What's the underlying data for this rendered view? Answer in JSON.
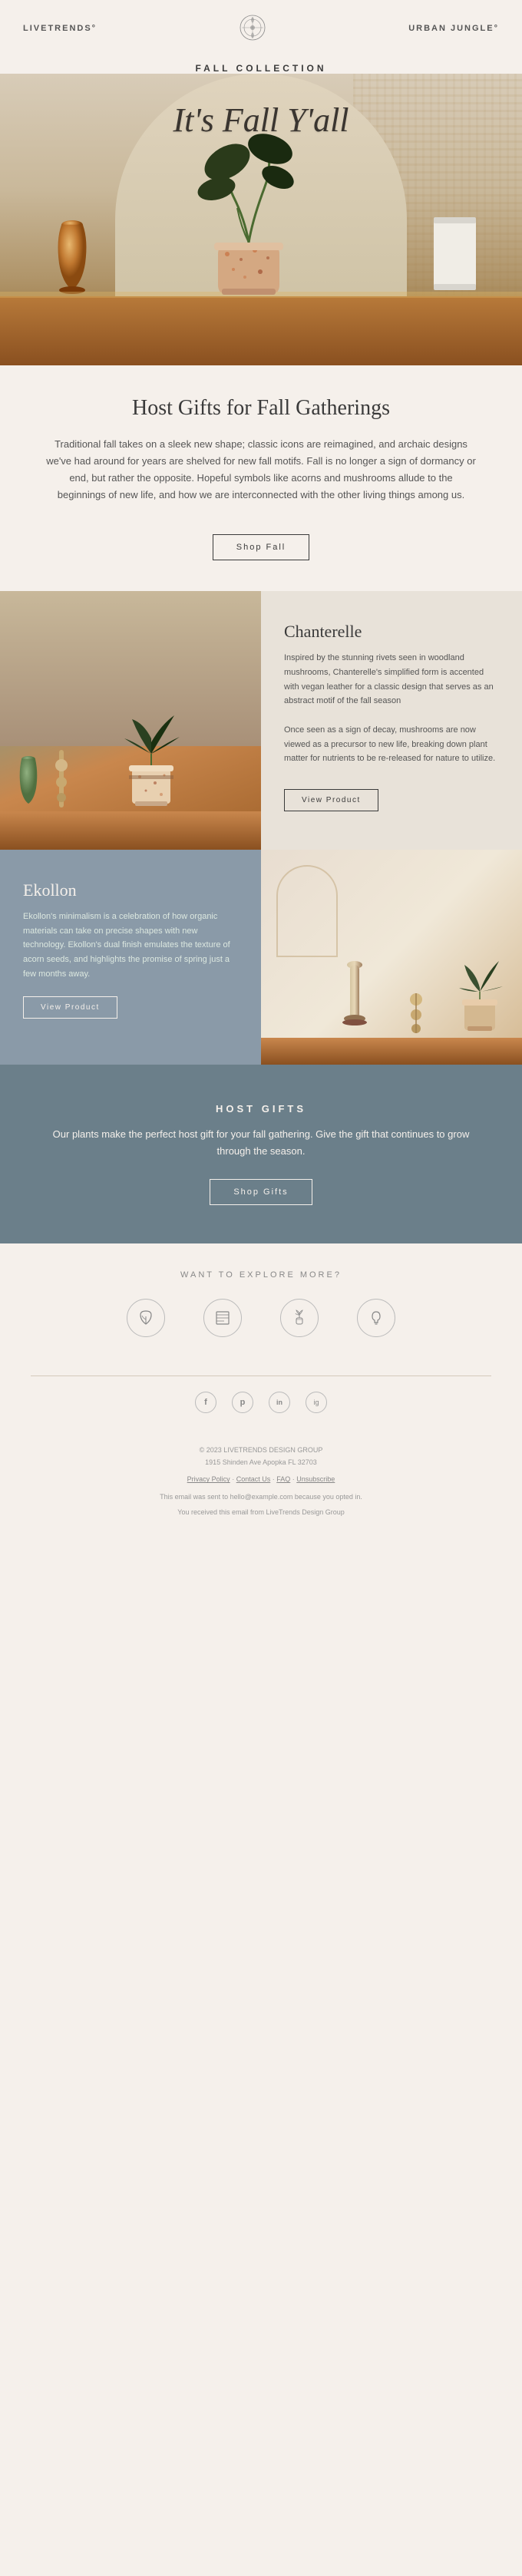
{
  "header": {
    "logo_left": "LIVETRENDS°",
    "logo_right": "URBAN JUNGLE°",
    "emblem_alt": "emblem"
  },
  "collection": {
    "label": "FALL COLLECTION",
    "hero_title": "It's Fall Y'all"
  },
  "hosting_section": {
    "heading": "Host Gifts for Fall Gatherings",
    "body": "Traditional fall takes on a sleek new shape; classic icons are reimagined, and archaic designs we've had around for years are shelved for new fall motifs. Fall is no longer a sign of dormancy or end, but rather the opposite. Hopeful symbols like acorns and mushrooms allude to the beginnings of new life, and how we are interconnected with the other living things among us.",
    "cta_label": "Shop Fall"
  },
  "products": {
    "chanterelle": {
      "name": "Chanterelle",
      "description": "Inspired by the stunning rivets seen in woodland mushrooms, Chanterelle's simplified form is accented with vegan leather for a classic design that serves as an abstract motif of the fall season\n\nOnce seen as a sign of decay, mushrooms are now viewed as a precursor to new life, breaking down plant matter for nutrients to be re-released for nature to utilize.",
      "cta_label": "View Product"
    },
    "ekollon": {
      "name": "Ekollon",
      "description": "Ekollon's minimalism is a celebration of how organic materials can take on precise shapes with new technology. Ekollon's dual finish emulates the texture of acorn seeds, and highlights the promise of spring just a few months away.",
      "cta_label": "View Product"
    }
  },
  "host_gifts": {
    "label": "HOST GIFTS",
    "heading": "HOST GIFTS",
    "body": "Our plants make the perfect host gift for your fall gathering. Give the gift that continues to grow through the season.",
    "cta_label": "Shop Gifts"
  },
  "explore": {
    "label": "WANT TO EXPLORE MORE?",
    "icons": [
      {
        "name": "leaf-icon",
        "symbol": "🌿",
        "label": ""
      },
      {
        "name": "catalog-icon",
        "symbol": "📋",
        "label": ""
      },
      {
        "name": "plant-pot-icon",
        "symbol": "🪴",
        "label": ""
      },
      {
        "name": "lightbulb-icon",
        "symbol": "💡",
        "label": ""
      }
    ]
  },
  "social": {
    "icons": [
      {
        "name": "facebook-icon",
        "symbol": "f"
      },
      {
        "name": "pinterest-icon",
        "symbol": "p"
      },
      {
        "name": "linkedin-icon",
        "symbol": "in"
      },
      {
        "name": "instagram-icon",
        "symbol": "ig"
      }
    ]
  },
  "footer": {
    "copyright": "© 2023 LIVETRENDS DESIGN GROUP",
    "address": "1915 Shinden Ave Apopka FL 32703",
    "links": {
      "privacy": "Privacy Policy",
      "contact": "Contact Us",
      "faq": "FAQ",
      "unsubscribe": "Unsubscribe"
    },
    "disclaimer": "This email was sent to hello@example.com because you opted in.",
    "powered_by": "You received this email from LiveTrends Design Group"
  }
}
